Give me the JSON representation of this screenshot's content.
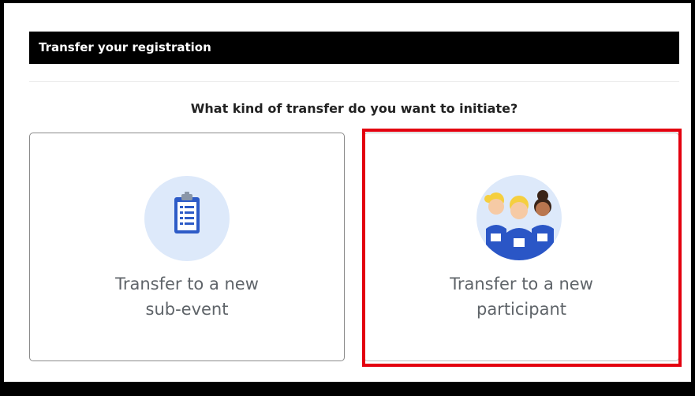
{
  "header": {
    "title": "Transfer your registration"
  },
  "question": "What kind of transfer do you want to initiate?",
  "options": [
    {
      "line1": "Transfer to a new",
      "line2": "sub-event",
      "icon": "clipboard-icon"
    },
    {
      "line1": "Transfer to a new",
      "line2": "participant",
      "icon": "participants-icon"
    }
  ],
  "colors": {
    "header_bg": "#000000",
    "icon_circle_bg": "#dde9fa",
    "highlight": "#e3000f",
    "label_text": "#5f6469"
  }
}
